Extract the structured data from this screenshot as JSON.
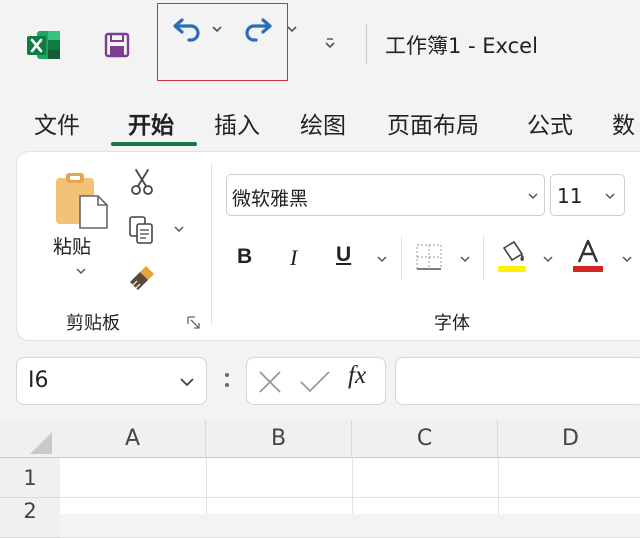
{
  "titlebar": {
    "title": "工作簿1  -  Excel",
    "icons": [
      "excel-logo",
      "save-icon",
      "undo-icon",
      "redo-icon",
      "customize-qat-icon"
    ]
  },
  "tabs": [
    {
      "label": "文件",
      "active": false
    },
    {
      "label": "开始",
      "active": true
    },
    {
      "label": "插入",
      "active": false
    },
    {
      "label": "绘图",
      "active": false
    },
    {
      "label": "页面布局",
      "active": false
    },
    {
      "label": "公式",
      "active": false
    },
    {
      "label": "数",
      "active": false
    }
  ],
  "ribbon": {
    "clipboard": {
      "paste_label": "粘贴",
      "group_label": "剪贴板"
    },
    "font": {
      "font_name": "微软雅黑",
      "font_size": "11",
      "bold": "B",
      "italic": "I",
      "underline": "U",
      "group_label": "字体"
    }
  },
  "formula_bar": {
    "name_box": "I6",
    "fx": "fx",
    "formula": ""
  },
  "grid": {
    "columns": [
      "A",
      "B",
      "C",
      "D"
    ],
    "rows": [
      "1",
      "2"
    ]
  },
  "colors": {
    "accent_green": "#1e7145",
    "highlight_box": "#c6333a",
    "fill_yellow": "#ffef00",
    "font_red": "#d42525",
    "undo_blue": "#2b6cb8"
  }
}
